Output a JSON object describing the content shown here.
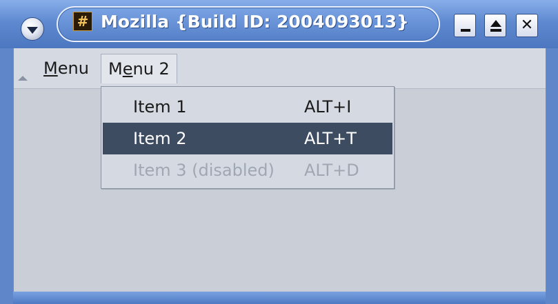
{
  "window": {
    "title": "Mozilla {Build ID: 2004093013}",
    "app_icon_glyph": "#",
    "close_glyph": "✕"
  },
  "menubar": {
    "items": [
      {
        "mnemonic": "M",
        "rest": "enu"
      },
      {
        "pre": "M",
        "mnemonic": "e",
        "rest": "nu 2"
      }
    ]
  },
  "dropdown": {
    "items": [
      {
        "label": "Item 1",
        "shortcut": "ALT+I",
        "state": "normal"
      },
      {
        "label": "Item 2",
        "shortcut": "ALT+T",
        "state": "highlighted"
      },
      {
        "label": "Item 3 (disabled)",
        "shortcut": "ALT+D",
        "state": "disabled"
      }
    ]
  },
  "colors": {
    "titlebar": "#5f8ad0",
    "window_bg": "#c9ced7",
    "highlight": "#3e4c62",
    "disabled_text": "#a1a7b2"
  }
}
